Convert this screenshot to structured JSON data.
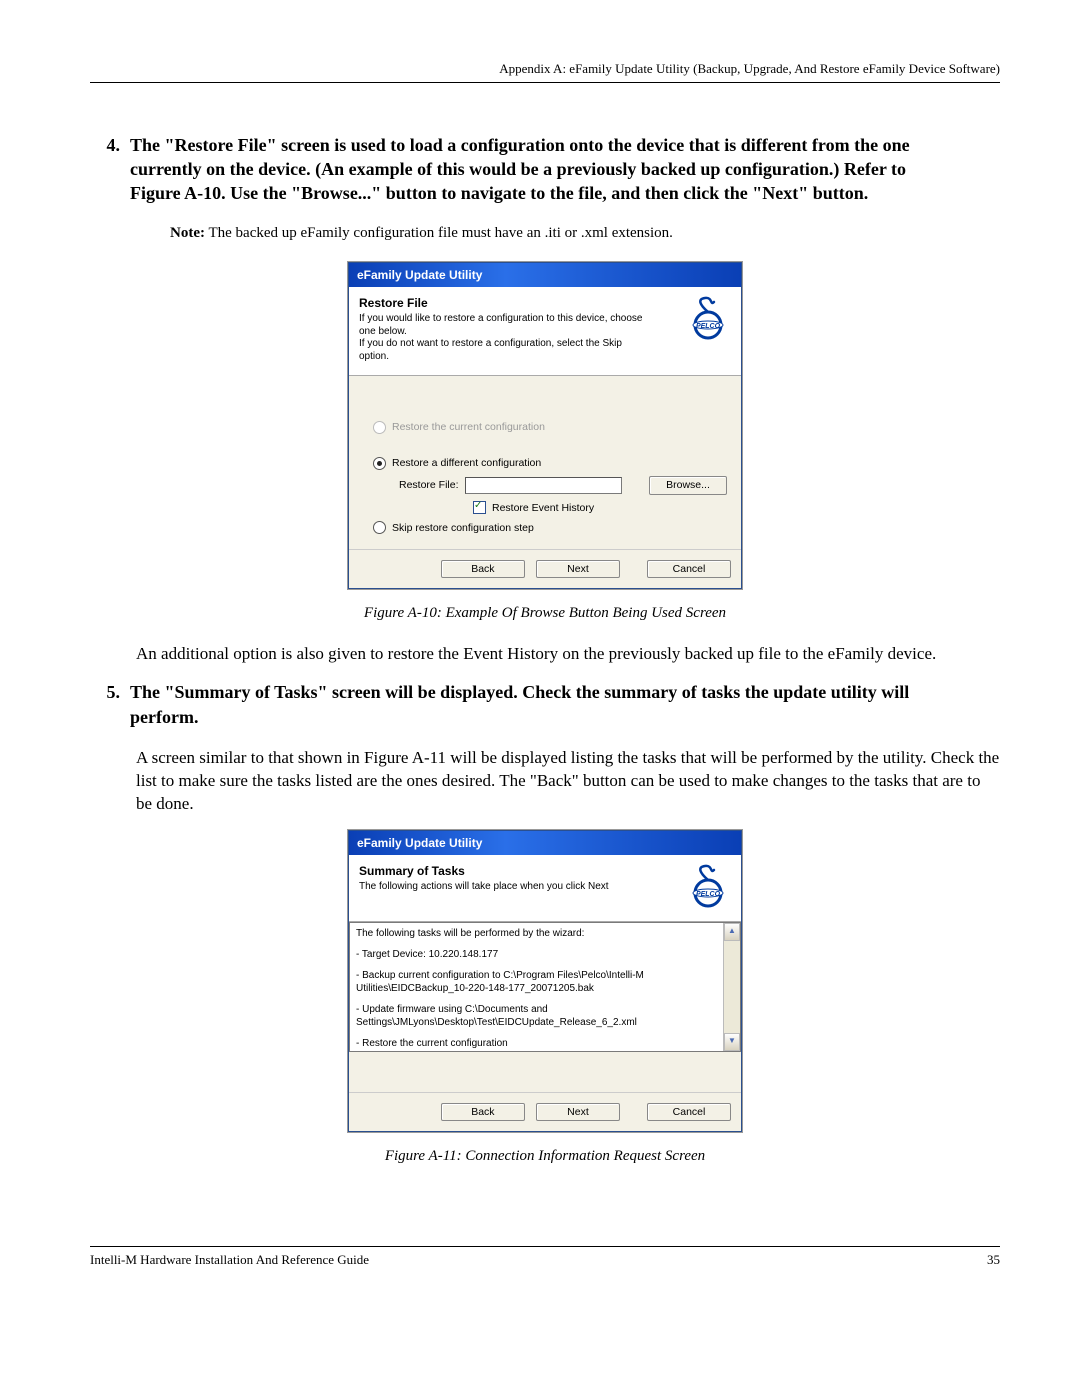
{
  "header": "Appendix A: eFamily Update Utility (Backup, Upgrade, And Restore eFamily Device Software)",
  "step4": {
    "num": "4.",
    "text": "The \"Restore File\" screen is used to load a configuration onto the device that is different from the one currently on the device.  (An example of this would be a previously backed up configuration.)  Refer to Figure A-10.  Use the \"Browse...\" button to navigate to the file, and then click the \"Next\" button."
  },
  "note": {
    "label": "Note:",
    "text": " The backed up eFamily configuration file must have an .iti or .xml extension."
  },
  "dialog1": {
    "title": "eFamily Update Utility",
    "hTitle": "Restore File",
    "hDesc1": "If you would like to restore a configuration to this device, choose one below.",
    "hDesc2": "If you do not want to restore a configuration, select the Skip option.",
    "opt1": "Restore the current configuration",
    "opt2": "Restore a different configuration",
    "restoreFileLabel": "Restore File:",
    "browse": "Browse...",
    "chkLabel": "Restore Event History",
    "opt3": "Skip restore configuration step",
    "back": "Back",
    "next": "Next",
    "cancel": "Cancel"
  },
  "fig1caption": "Figure A-10: Example Of Browse Button Being Used Screen",
  "para1": "An additional option is also given to restore the Event History on the previously backed up file to the eFamily device.",
  "step5": {
    "num": "5.",
    "text": "The \"Summary of Tasks\" screen will be displayed.  Check the summary of tasks the update utility will perform."
  },
  "para2": "A screen similar to that shown in Figure A-11 will be displayed listing the tasks that will be performed by the utility.  Check the list to make sure the tasks listed are the ones desired.  The \"Back\" button can be used to make changes to the tasks that are to be done.",
  "dialog2": {
    "title": "eFamily Update Utility",
    "hTitle": "Summary of Tasks",
    "hDesc": "The following actions will take place when you click Next",
    "line1": "The following tasks will be performed by the wizard:",
    "line2": "- Target Device: 10.220.148.177",
    "line3": "- Backup current configuration to C:\\Program Files\\Pelco\\Intelli-M Utilities\\EIDCBackup_10-220-148-177_20071205.bak",
    "line4": "- Update firmware using C:\\Documents and Settings\\JMLyons\\Desktop\\Test\\EIDCUpdate_Release_6_2.xml",
    "line5": "- Restore the current configuration",
    "back": "Back",
    "next": "Next",
    "cancel": "Cancel"
  },
  "fig2caption": "Figure A-11: Connection Information Request Screen",
  "footer": {
    "left": "Intelli-M Hardware Installation And Reference Guide",
    "right": "35"
  },
  "logoText": "PELCO"
}
